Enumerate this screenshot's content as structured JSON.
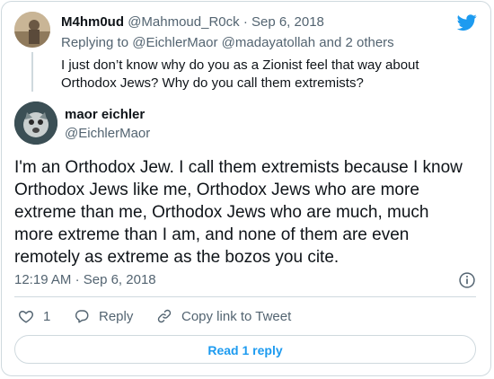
{
  "reply_tweet": {
    "name": "M4hm0ud",
    "handle": "@Mahmoud_R0ck",
    "separator": "·",
    "date": "Sep 6, 2018",
    "replying_prefix": "Replying to",
    "replying_user1": "@EichlerMaor",
    "replying_user2": "@madayatollah",
    "replying_suffix": "and 2 others",
    "text": "I just don’t know why do you as a Zionist feel that way about Orthodox Jews? Why do you call them extremists?"
  },
  "main_tweet": {
    "name": "maor eichler",
    "handle": "@EichlerMaor",
    "text": "I'm an Orthodox Jew. I call them extremists because I know Orthodox Jews like me, Orthodox Jews who are more extreme than me, Orthodox Jews who are much, much more extreme than I am, and none of them are even remotely as extreme as the bozos you cite.",
    "time": "12:19 AM",
    "separator": "·",
    "date": "Sep 6, 2018"
  },
  "actions": {
    "like_count": "1",
    "reply_label": "Reply",
    "copy_label": "Copy link to Tweet"
  },
  "read_replies_label": "Read 1 reply",
  "icons": {
    "logo": "twitter-bird-icon",
    "info": "info-icon",
    "like": "heart-icon",
    "reply": "speech-bubble-icon",
    "copy": "link-icon"
  },
  "colors": {
    "accent": "#1d9bf0",
    "text": "#0f1419",
    "muted": "#536471",
    "border": "#cfd9de"
  }
}
